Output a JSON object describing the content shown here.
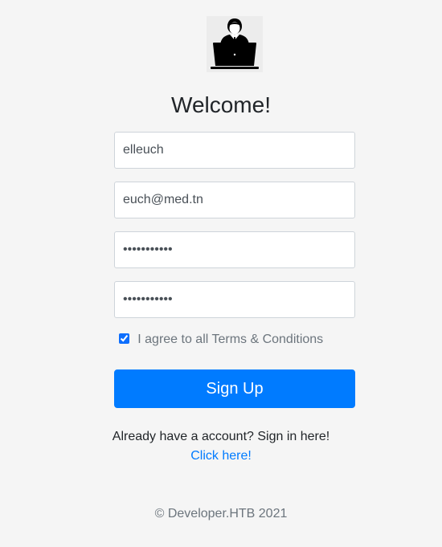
{
  "logo": {
    "icon": "developer-laptop-icon"
  },
  "form": {
    "title": "Welcome!",
    "username_value": "elleuch",
    "email_value": "euch@med.tn",
    "password_value": "elleuch1234",
    "confirm_password_value": "elleuch1234",
    "terms_checked": true,
    "terms_label": "I agree to all Terms & Conditions",
    "submit_label": "Sign Up",
    "signin_text": "Already have a account? Sign in here!",
    "signin_link": "Click here!"
  },
  "footer": {
    "text": "© Developer.HTB 2021"
  },
  "colors": {
    "primary": "#007bff",
    "background": "#f5f5f5",
    "muted": "#6c757d"
  }
}
